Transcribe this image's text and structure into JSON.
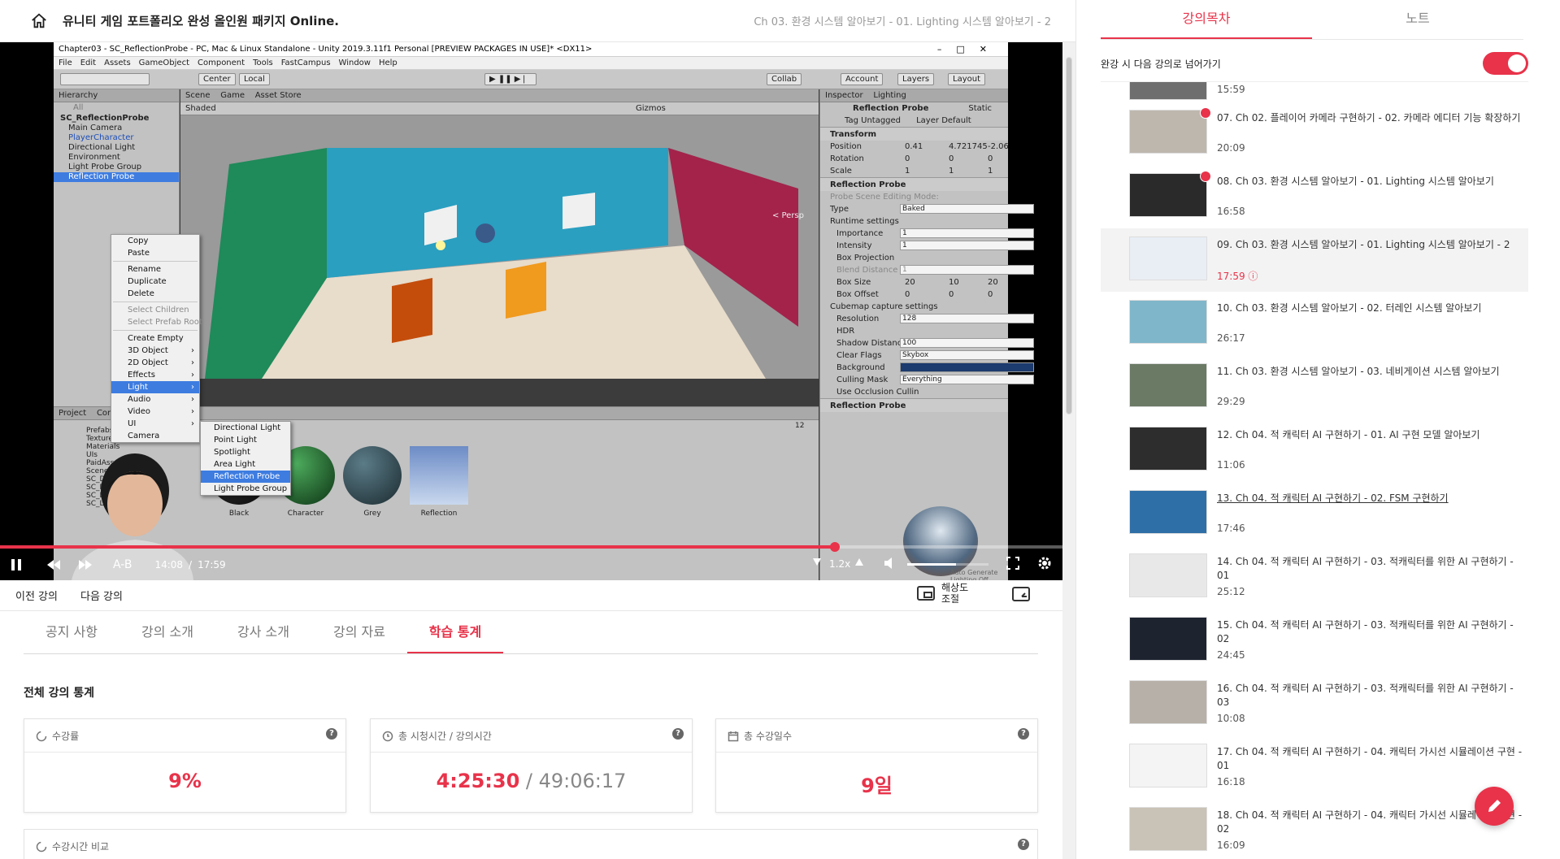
{
  "header": {
    "course_title": "유니티 게임 포트폴리오 완성 올인원 패키지 Online.",
    "lecture_crumb": "Ch 03. 환경 시스템 알아보기 - 01. Lighting 시스템 알아보기 - 2"
  },
  "video": {
    "unity_title": "Chapter03 - SC_ReflectionProbe - PC, Mac & Linux Standalone - Unity 2019.3.11f1 Personal [PREVIEW PACKAGES IN USE]* <DX11>",
    "unity_menu": [
      "File",
      "Edit",
      "Assets",
      "GameObject",
      "Component",
      "Tools",
      "FastCampus",
      "Window",
      "Help"
    ],
    "toolbar": {
      "center": "Center",
      "local": "Local",
      "collab": "Collab",
      "account": "Account",
      "layers": "Layers",
      "layout": "Layout"
    },
    "hierarchy": {
      "tab": "Hierarchy",
      "search": "All",
      "rows": [
        "SC_ReflectionProbe",
        "Main Camera",
        "PlayerCharacter",
        "Directional Light",
        "Environment",
        "Light Probe Group",
        "Reflection Probe"
      ]
    },
    "scene": {
      "tab_scene": "Scene",
      "tab_game": "Game",
      "tab_asset_store": "Asset Store",
      "shaded": "Shaded",
      "gizmos": "Gizmos",
      "persp": "< Persp"
    },
    "context_menu": {
      "items": [
        "Copy",
        "Paste",
        "Rename",
        "Duplicate",
        "Delete",
        "Select Children",
        "Select Prefab Root",
        "Create Empty",
        "3D Object",
        "2D Object",
        "Effects",
        "Light",
        "Audio",
        "Video",
        "UI",
        "Camera"
      ],
      "submenu": [
        "Directional Light",
        "Point Light",
        "Spotlight",
        "Area Light",
        "Reflection Probe",
        "Light Probe Group"
      ]
    },
    "inspector": {
      "tab_inspector": "Inspector",
      "tab_lighting": "Lighting",
      "object_name": "Reflection Probe",
      "static_label": "Static",
      "tag_label": "Tag",
      "tag_value": "Untagged",
      "layer_label": "Layer",
      "layer_value": "Default",
      "transform": "Transform",
      "position": "Position",
      "position_x": "0.41",
      "position_y": "4.721745",
      "position_z": "-2.06",
      "rotation": "Rotation",
      "rotation_x": "0",
      "rotation_y": "0",
      "rotation_z": "0",
      "scale": "Scale",
      "scale_x": "1",
      "scale_y": "1",
      "scale_z": "1",
      "component": "Reflection Probe",
      "editing_mode": "Probe Scene Editing Mode:",
      "type_label": "Type",
      "type_value": "Baked",
      "runtime": "Runtime settings",
      "importance": "Importance",
      "importance_value": "1",
      "intensity": "Intensity",
      "intensity_value": "1",
      "box_projection": "Box Projection",
      "blend_distance": "Blend Distance",
      "blend_value": "1",
      "box_size": "Box Size",
      "box_size_x": "20",
      "box_size_y": "10",
      "box_size_z": "20",
      "box_offset": "Box Offset",
      "box_offset_x": "0",
      "box_offset_y": "0",
      "box_offset_z": "0",
      "cubemap": "Cubemap capture settings",
      "resolution": "Resolution",
      "resolution_value": "128",
      "hdr": "HDR",
      "shadow_distance": "Shadow Distance",
      "shadow_value": "100",
      "clear_flags": "Clear Flags",
      "clear_value": "Skybox",
      "background": "Background",
      "culling_mask": "Culling Mask",
      "culling_value": "Everything",
      "occlusion": "Use Occlusion Cullin",
      "preview_label": "Reflection Probe",
      "auto_generate": "Auto Generate Lighting Off"
    },
    "project": {
      "tab_project": "Project",
      "tab_console": "Cons",
      "folders": [
        "Prefabs",
        "Textures",
        "Materials",
        "UIs",
        "PaidAssets",
        "Scenes",
        "SC_Dung",
        "SC_Dung",
        "SC_Lightm",
        "SC_Li"
      ],
      "assets": [
        "Black",
        "Character",
        "Grey",
        "Reflection"
      ],
      "count": "12"
    },
    "player": {
      "current_time": "14:08",
      "separator": "/",
      "total_time": "17:59",
      "progress": 0.786,
      "ab_label": "A-B",
      "speed": "1.2x",
      "volume": 0.6
    }
  },
  "below_video": {
    "prev_lecture": "이전 강의",
    "next_lecture": "다음 강의",
    "resolution_label_1": "해상도",
    "resolution_label_2": "조절"
  },
  "tabs": [
    "공지 사항",
    "강의 소개",
    "강사 소개",
    "강의 자료",
    "학습 통계"
  ],
  "stats": {
    "section_title": "전체 강의 통계",
    "cards": [
      {
        "label": "수강률",
        "value": "9%"
      },
      {
        "label": "총 시청시간 / 강의시간",
        "value_main": "4:25:30",
        "value_muted": " / 49:06:17"
      },
      {
        "label": "총 수강일수",
        "value": "9일"
      }
    ],
    "compare_label": "수강시간 비교"
  },
  "sidebar": {
    "tab_curriculum": "강의목차",
    "tab_notes": "노트",
    "autoplay_label": "완강 시 다음 강의로 넘어가기",
    "autoplay_on": true,
    "items": [
      {
        "title": "",
        "duration": "15:59",
        "done": false
      },
      {
        "title": "07. Ch 02. 플레이어 카메라 구현하기 - 02. 카메라 에디터 기능 확장하기",
        "duration": "20:09",
        "done": true
      },
      {
        "title": "08. Ch 03. 환경 시스템 알아보기 - 01. Lighting 시스템 알아보기",
        "duration": "16:58",
        "done": true
      },
      {
        "title": "09. Ch 03. 환경 시스템 알아보기 - 01. Lighting 시스템 알아보기 - 2",
        "duration": "17:59",
        "current": true
      },
      {
        "title": "10. Ch 03. 환경 시스템 알아보기 - 02. 터레인 시스템 알아보기",
        "duration": "26:17"
      },
      {
        "title": "11. Ch 03. 환경 시스템 알아보기 - 03. 네비게이션 시스템 알아보기",
        "duration": "29:29"
      },
      {
        "title": "12. Ch 04. 적 캐릭터 AI 구현하기 - 01. AI 구현 모델 알아보기",
        "duration": "11:06"
      },
      {
        "title": "13. Ch 04. 적 캐릭터 AI 구현하기 - 02. FSM 구현하기",
        "duration": "17:46",
        "underline": true
      },
      {
        "title": "14. Ch 04. 적 캐릭터 AI 구현하기 - 03. 적캐릭터를 위한 AI 구현하기 - 01",
        "duration": "25:12"
      },
      {
        "title": "15. Ch 04. 적 캐릭터 AI 구현하기 - 03. 적캐릭터를 위한 AI 구현하기 - 02",
        "duration": "24:45"
      },
      {
        "title": "16. Ch 04. 적 캐릭터 AI 구현하기 - 03. 적캐릭터를 위한 AI 구현하기 - 03",
        "duration": "10:08"
      },
      {
        "title": "17. Ch 04. 적 캐릭터 AI 구현하기 - 04. 캐릭터 가시선 시뮬레이션 구현 - 01",
        "duration": "16:18"
      },
      {
        "title": "18. Ch 04. 적 캐릭터 AI 구현하기 - 04. 캐릭터 가시선 시뮬레이션 구현 - 02",
        "duration": "16:09"
      }
    ]
  },
  "colors": {
    "accent": "#e8334a",
    "text": "#222222",
    "muted": "#888888"
  },
  "icons": [
    "home-icon",
    "play-pause-icon",
    "rewind-icon",
    "forward-icon",
    "volume-icon",
    "fullscreen-icon",
    "settings-icon",
    "pip-icon",
    "resolution-icon",
    "help-icon",
    "pencil-icon",
    "check-icon",
    "clock-icon",
    "calendar-icon"
  ]
}
